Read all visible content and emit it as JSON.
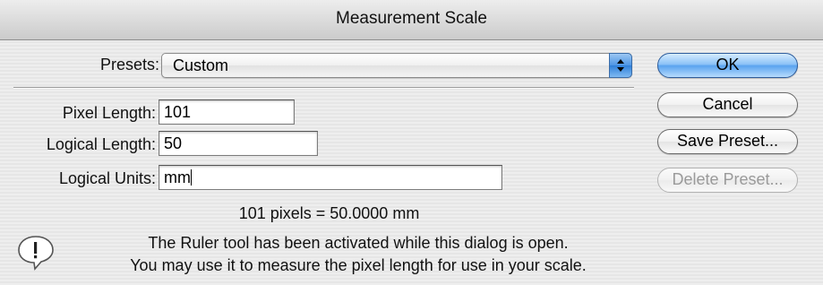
{
  "window": {
    "title": "Measurement Scale"
  },
  "presets": {
    "label": "Presets:",
    "selected": "Custom"
  },
  "fields": {
    "pixel_length": {
      "label": "Pixel Length:",
      "value": "101"
    },
    "logical_length": {
      "label": "Logical Length:",
      "value": "50"
    },
    "logical_units": {
      "label": "Logical Units:",
      "value": "mm"
    }
  },
  "buttons": {
    "ok": "OK",
    "cancel": "Cancel",
    "save_preset": "Save Preset...",
    "delete_preset": "Delete Preset..."
  },
  "result_text": "101 pixels = 50.0000 mm",
  "info": {
    "icon": "exclamation-speech-bubble-icon",
    "line1": "The Ruler tool has been activated while this dialog is open.",
    "line2": "You may use it to measure the pixel length for use in your scale."
  },
  "colors": {
    "default_button": "#5aa3ef",
    "popup_arrows": "#4d95e4",
    "disabled_text": "#9a9a9a"
  }
}
